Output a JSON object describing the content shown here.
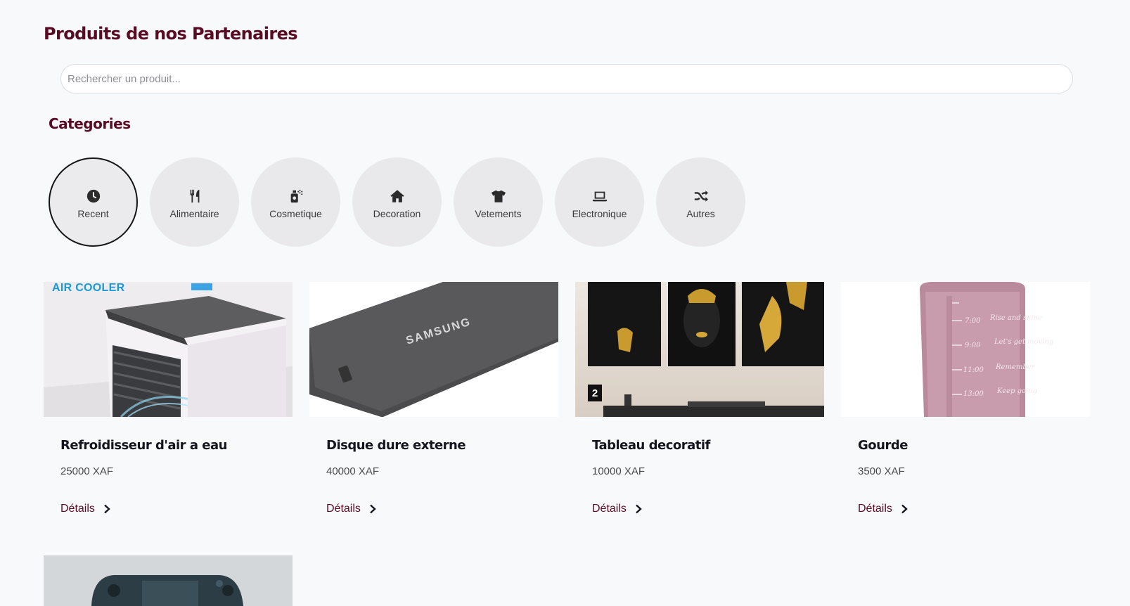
{
  "page": {
    "title": "Produits de nos Partenaires"
  },
  "search": {
    "placeholder": "Rechercher un produit..."
  },
  "categories_section": {
    "title": "Categories",
    "items": [
      {
        "label": "Recent",
        "icon": "clock-icon",
        "active": true
      },
      {
        "label": "Alimentaire",
        "icon": "utensils-icon"
      },
      {
        "label": "Cosmetique",
        "icon": "spray-bottle-icon"
      },
      {
        "label": "Decoration",
        "icon": "home-icon"
      },
      {
        "label": "Vetements",
        "icon": "tshirt-icon"
      },
      {
        "label": "Electronique",
        "icon": "laptop-icon"
      },
      {
        "label": "Autres",
        "icon": "shuffle-icon"
      }
    ]
  },
  "products": [
    {
      "name": "Refroidisseur d'air a eau",
      "price": "25000 XAF",
      "link": "Détails",
      "image": "air-cooler-image",
      "image_text": "AIR COOLER"
    },
    {
      "name": "Disque dure externe",
      "price": "40000 XAF",
      "link": "Détails",
      "image": "external-ssd-image",
      "image_text": "SAMSUNG"
    },
    {
      "name": "Tableau decoratif",
      "price": "10000 XAF",
      "link": "Détails",
      "image": "wall-art-image",
      "image_text": "2"
    },
    {
      "name": "Gourde",
      "price": "3500 XAF",
      "link": "Détails",
      "image": "water-bottle-image"
    }
  ],
  "partial_product": {
    "image": "game-controller-image"
  },
  "colors": {
    "brand": "#5a0b24",
    "category_bg": "#e9e9ec",
    "background": "#f8f9fb"
  }
}
